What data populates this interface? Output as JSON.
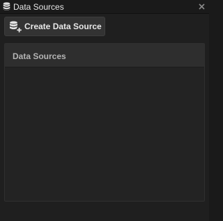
{
  "panel": {
    "title": "Data Sources",
    "icon": "database-icon",
    "close_icon": "close-icon"
  },
  "toolbar": {
    "create_label": "Create Data Source",
    "create_icon": "database-add-icon"
  },
  "list": {
    "header": "Data Sources",
    "items": []
  },
  "colors": {
    "background": "#1f1f1f",
    "button": "#333333",
    "list_header": "#2e2e2e",
    "text": "#e6e6e6"
  }
}
